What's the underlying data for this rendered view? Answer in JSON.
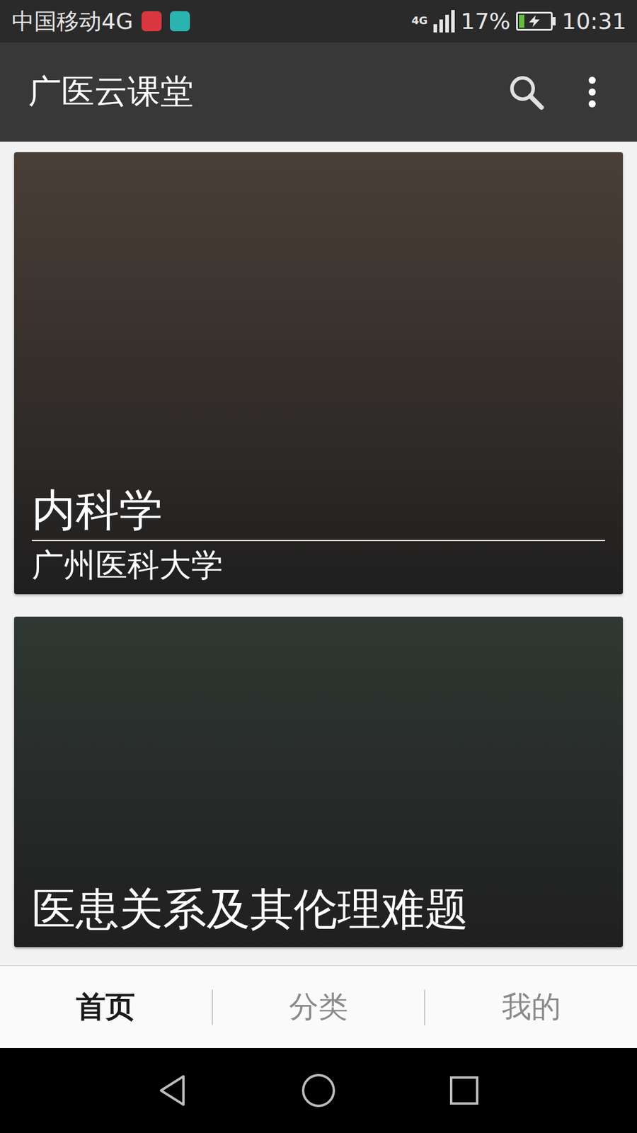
{
  "status_bar": {
    "carrier": "中国移动4G",
    "network": "4G",
    "signal_level": 1,
    "battery": "17%",
    "battery_level": 0.17,
    "charging": true,
    "time": "10:31",
    "notifications": [
      {
        "app": "huawei",
        "color": "#d9373f"
      },
      {
        "app": "android",
        "color": "#2bb3b0"
      }
    ]
  },
  "app_bar": {
    "title": "广医云课堂"
  },
  "courses": [
    {
      "title": "内科学",
      "school": "广州医科大学",
      "color": "#4a3f37"
    },
    {
      "title": "医患关系及其伦理难题",
      "color": "#2f3833"
    }
  ],
  "bottom_nav": [
    {
      "label": "首页",
      "selected": true
    },
    {
      "label": "分类",
      "selected": false
    },
    {
      "label": "我的",
      "selected": false
    }
  ]
}
